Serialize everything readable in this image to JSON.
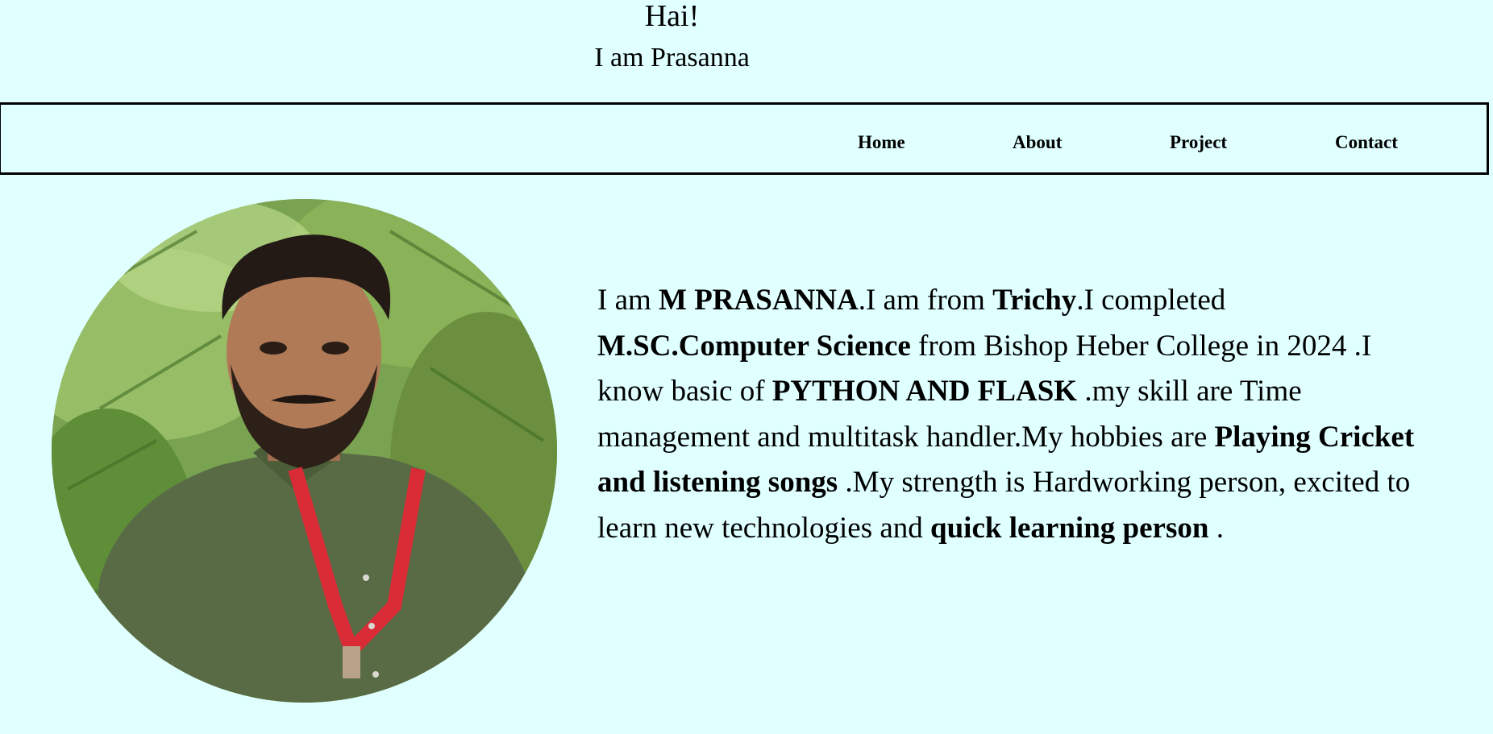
{
  "hero": {
    "greeting": "Hai!",
    "intro": "I am Prasanna"
  },
  "nav": {
    "home": "Home",
    "about": "About",
    "project": "Project",
    "contact": "Contact"
  },
  "profile": {
    "photo_alt": "Profile photo"
  },
  "bio": {
    "t1": "I am ",
    "b1": "M PRASANNA",
    "t2": ".I am from ",
    "b2": "Trichy",
    "t3": ".I completed ",
    "b3": "M.SC.Computer Science",
    "t4": " from Bishop Heber College in 2024 .I know basic of ",
    "b4": "PYTHON AND FLASK",
    "t5": " .my skill are Time management and multitask handler.My hobbies are ",
    "b5": "Playing Cricket and listening songs",
    "t6": " .My strength is Hardworking person, excited to learn new technologies and ",
    "b6": "quick learning person",
    "t7": " ."
  },
  "colors": {
    "background": "#e0ffff",
    "text": "#000000",
    "navbar_border": "#000000"
  },
  "icons": {
    "photo": "profile-photo"
  }
}
